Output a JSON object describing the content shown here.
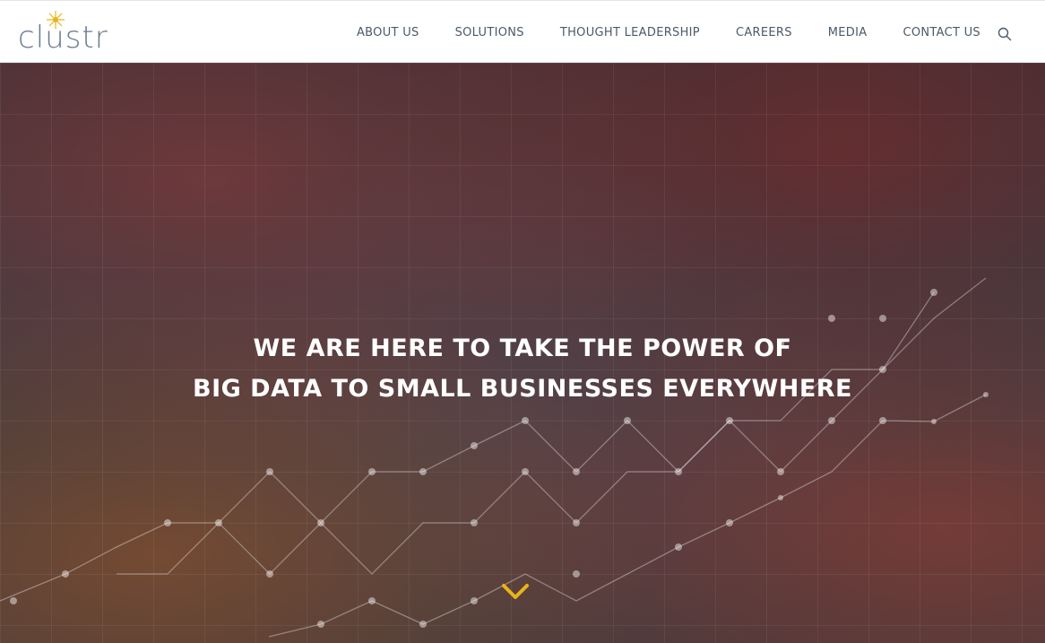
{
  "brand": {
    "logo_text": "clustr",
    "accent_color": "#e8b418"
  },
  "nav": {
    "items": [
      {
        "label": "ABOUT US"
      },
      {
        "label": "SOLUTIONS"
      },
      {
        "label": "THOUGHT LEADERSHIP"
      },
      {
        "label": "CAREERS"
      },
      {
        "label": "MEDIA"
      },
      {
        "label": "CONTACT US"
      }
    ],
    "search_icon": "search-icon"
  },
  "hero": {
    "headline_line1": "WE ARE HERE TO TAKE THE POWER OF",
    "headline_line2": "BIG DATA TO SMALL BUSINESSES EVERYWHERE",
    "scroll_icon": "chevron-down-icon"
  }
}
